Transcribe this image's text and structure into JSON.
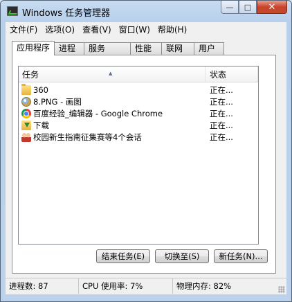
{
  "window": {
    "title": "Windows 任务管理器"
  },
  "title_buttons": {
    "minimize": "—",
    "restore": "□",
    "close": "✕"
  },
  "menu": [
    "文件(F)",
    "选项(O)",
    "查看(V)",
    "窗口(W)",
    "帮助(H)"
  ],
  "tabs": [
    "应用程序",
    "进程",
    "服务",
    "性能",
    "联网",
    "用户"
  ],
  "active_tab": "应用程序",
  "list": {
    "columns": {
      "task": "任务",
      "status": "状态"
    },
    "rows": [
      {
        "icon": "folder-icon",
        "name": "360",
        "status": "正在..."
      },
      {
        "icon": "paint-icon",
        "name": "8.PNG - 画图",
        "status": "正在..."
      },
      {
        "icon": "chrome-icon",
        "name": "百度经验_编辑器 - Google Chrome",
        "status": "正在..."
      },
      {
        "icon": "download-folder-icon",
        "name": "下载",
        "status": "正在..."
      },
      {
        "icon": "users-icon",
        "name": "校园新生指南征集赛等4个会话",
        "status": "正在..."
      }
    ]
  },
  "buttons": {
    "end_task": "结束任务(E)",
    "switch_to": "切换至(S)",
    "new_task": "新任务(N)..."
  },
  "statusbar": {
    "processes": "进程数: 87",
    "cpu": "CPU 使用率: 7%",
    "memory": "物理内存: 82%"
  }
}
